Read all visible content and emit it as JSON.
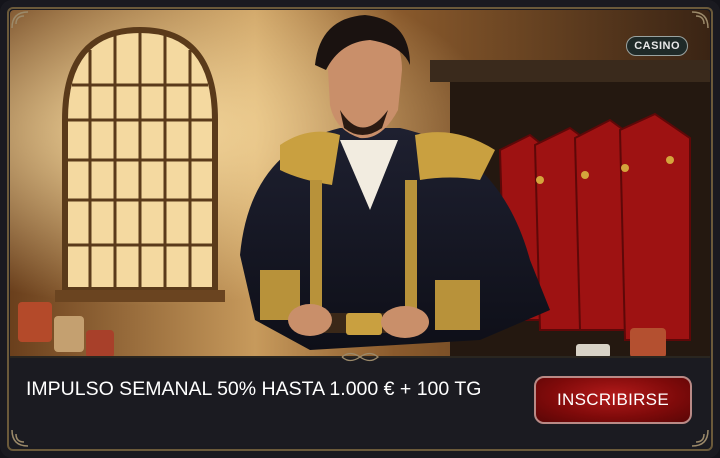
{
  "badge": {
    "label": "CASINO"
  },
  "promo": {
    "text": "IMPULSO SEMANAL 50% HASTA 1.000 € + 100 TG"
  },
  "cta": {
    "label": "INSCRIBIRSE"
  },
  "colors": {
    "accent_red": "#8b0c0c",
    "gold": "#c8a24a",
    "panel": "#1b1b21"
  }
}
